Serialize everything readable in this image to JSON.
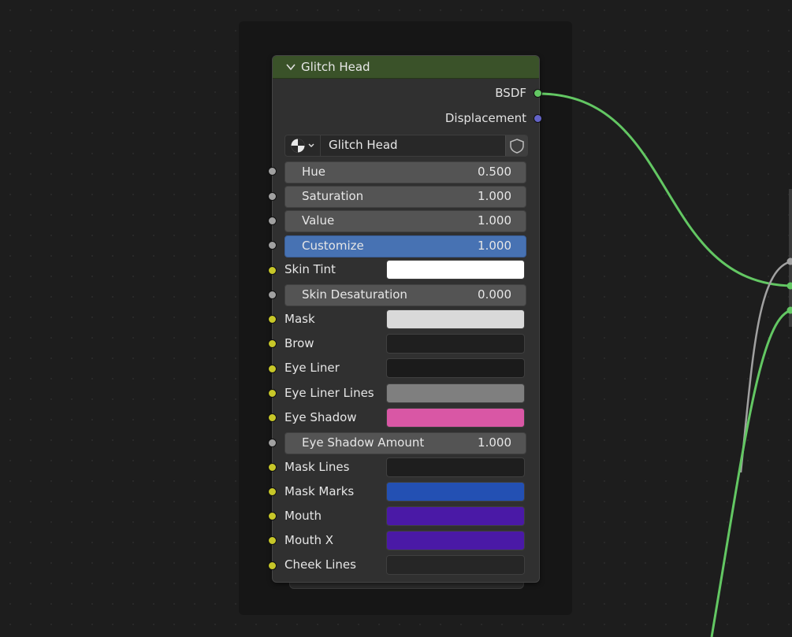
{
  "node": {
    "title": "Glitch Head",
    "outputs": [
      "BSDF",
      "Displacement"
    ],
    "group_name": "Glitch Head",
    "sliders": [
      {
        "label": "Hue",
        "value": "0.500",
        "active": false
      },
      {
        "label": "Saturation",
        "value": "1.000",
        "active": false
      },
      {
        "label": "Value",
        "value": "1.000",
        "active": false
      },
      {
        "label": "Customize",
        "value": "1.000",
        "active": true
      },
      {
        "label": "Skin Desaturation",
        "value": "0.000",
        "active": false
      },
      {
        "label": "Eye Shadow Amount",
        "value": "1.000",
        "active": false
      }
    ],
    "colors": [
      {
        "label": "Skin Tint",
        "color": "#ffffff"
      },
      {
        "label": "Mask",
        "color": "#d9d9d9"
      },
      {
        "label": "Brow",
        "color": "#1f1f1f"
      },
      {
        "label": "Eye Liner",
        "color": "#1b1b1b"
      },
      {
        "label": "Eye Liner Lines",
        "color": "#7f7f7f"
      },
      {
        "label": "Eye Shadow",
        "color": "#d957a5"
      },
      {
        "label": "Mask Lines",
        "color": "#1e1e1e"
      },
      {
        "label": "Mask Marks",
        "color": "#2350b3"
      },
      {
        "label": "Mouth",
        "color": "#4a19a6"
      },
      {
        "label": "Mouth X",
        "color": "#4a19a6"
      },
      {
        "label": "Cheek Lines",
        "color": "#262626"
      }
    ]
  },
  "colors": {
    "header": "#3a5229",
    "accent": "#4772b3",
    "link_green": "#63c763",
    "link_grey": "#a1a1a1",
    "socket_yellow": "#c7c729",
    "socket_purple": "#6363c7"
  },
  "icons": {
    "collapse": "chevron-down-icon",
    "datablock": "node-tree-icon",
    "fake_user": "shield-icon"
  }
}
